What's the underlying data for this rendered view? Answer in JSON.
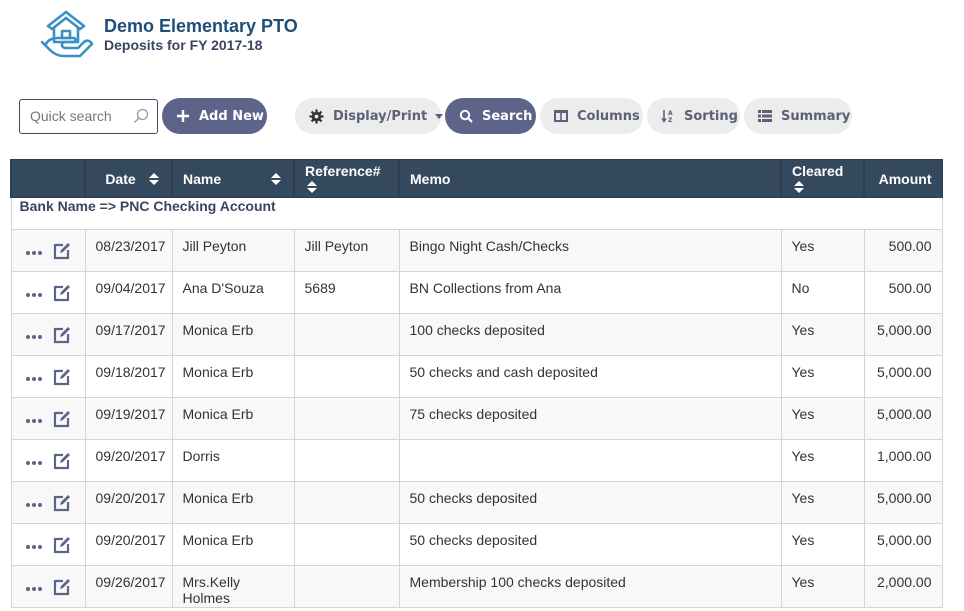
{
  "header": {
    "logo_icon": "house-in-hand-icon",
    "title": "Demo Elementary PTO",
    "subtitle": "Deposits for FY 2017-18"
  },
  "toolbar": {
    "search_placeholder": "Quick search",
    "search_value": "",
    "add_new_label": "Add New",
    "display_print_label": "Display/Print",
    "search_label": "Search",
    "columns_label": "Columns",
    "sorting_label": "Sorting",
    "summary_label": "Summary"
  },
  "colors": {
    "primary_button": "#5c6489",
    "light_button": "#ececec",
    "table_header": "#34495e",
    "title": "#1f4e79"
  },
  "table": {
    "columns": [
      "",
      "Date",
      "Name",
      "Reference#",
      "Memo",
      "Cleared",
      "Amount"
    ],
    "group_label": "Bank Name => PNC Checking Account",
    "rows": [
      {
        "date": "08/23/2017",
        "name": "Jill Peyton",
        "reference": "Jill Peyton",
        "memo": "Bingo Night Cash/Checks",
        "cleared": "Yes",
        "amount": "500.00"
      },
      {
        "date": "09/04/2017",
        "name": "Ana D'Souza",
        "reference": "5689",
        "memo": "BN Collections from Ana",
        "cleared": "No",
        "amount": "500.00"
      },
      {
        "date": "09/17/2017",
        "name": "Monica Erb",
        "reference": "",
        "memo": "100 checks deposited",
        "cleared": "Yes",
        "amount": "5,000.00"
      },
      {
        "date": "09/18/2017",
        "name": "Monica Erb",
        "reference": "",
        "memo": "50 checks and cash deposited",
        "cleared": "Yes",
        "amount": "5,000.00"
      },
      {
        "date": "09/19/2017",
        "name": "Monica Erb",
        "reference": "",
        "memo": "75 checks deposited",
        "cleared": "Yes",
        "amount": "5,000.00"
      },
      {
        "date": "09/20/2017",
        "name": "Dorris",
        "reference": "",
        "memo": "",
        "cleared": "Yes",
        "amount": "1,000.00"
      },
      {
        "date": "09/20/2017",
        "name": "Monica Erb",
        "reference": "",
        "memo": "50 checks deposited",
        "cleared": "Yes",
        "amount": "5,000.00"
      },
      {
        "date": "09/20/2017",
        "name": "Monica Erb",
        "reference": "",
        "memo": "50 checks deposited",
        "cleared": "Yes",
        "amount": "5,000.00"
      },
      {
        "date": "09/26/2017",
        "name": "Mrs.Kelly Holmes",
        "reference": "",
        "memo": "Membership 100 checks deposited",
        "cleared": "Yes",
        "amount": "2,000.00"
      }
    ]
  }
}
